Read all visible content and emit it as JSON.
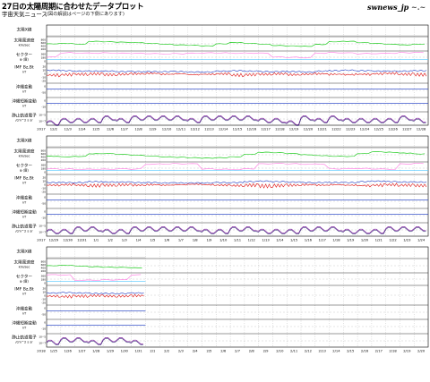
{
  "header": {
    "title": "27日の太陽周期に合わせたデータプロット",
    "subtitle": "宇宙天気ニュース",
    "note": "(図の解説はページの下側にあります)",
    "logo": "swnews_jp",
    "logo_mark": "~.~"
  },
  "colors": {
    "green": "#22cc22",
    "blue": "#1030c0",
    "red": "#e01010",
    "pink": "#ff70e0",
    "cyan": "#50c8ff",
    "purple": "#8020a0",
    "navy": "#101060",
    "gray": "#888888",
    "orange": "#ff9040"
  },
  "panel_labels": [
    {
      "id": "xray",
      "lines": [
        "太陽X線",
        "C/M/X上"
      ],
      "unit": ""
    },
    {
      "id": "wind",
      "lines": [
        "太陽風速度"
      ],
      "unit": "km/sec"
    },
    {
      "id": "sector",
      "lines": [
        "セクター"
      ],
      "unit": "φ (度)"
    },
    {
      "id": "imf",
      "lines": [
        "IMF Bz,Bt"
      ],
      "unit": "nT"
    },
    {
      "id": "dst",
      "lines": [
        "沖縄変動"
      ],
      "unit": "nT"
    },
    {
      "id": "short",
      "lines": [
        "沖縄短期変動"
      ],
      "unit": "nT"
    },
    {
      "id": "elec",
      "lines": [
        "静止軌道電子"
      ],
      "unit": "/cm^2 s sr"
    }
  ],
  "axis_ticks": {
    "wind": [
      "800",
      "600",
      "400",
      "200"
    ],
    "sector": [
      "360",
      "180",
      "0"
    ],
    "imf": [
      "20",
      "10",
      "0",
      "-10",
      "-20"
    ],
    "dst": [
      "0",
      "-50"
    ],
    "short": [
      "0",
      "-10"
    ],
    "elec": [
      "10^5",
      "10^7"
    ]
  },
  "blocks": [
    {
      "year": "2017",
      "dates": [
        "12/2",
        "12/3",
        "12/4",
        "12/5",
        "12/6",
        "12/7",
        "12/8",
        "12/9",
        "12/10",
        "12/11",
        "12/12",
        "12/13",
        "12/14",
        "12/15",
        "12/16",
        "12/17",
        "12/18",
        "12/19",
        "12/20",
        "12/21",
        "12/22",
        "12/23",
        "12/24",
        "12/25",
        "12/26",
        "12/27",
        "12/28"
      ],
      "wind": [
        500,
        520,
        480,
        620,
        600,
        580,
        560,
        520,
        480,
        450,
        430,
        400,
        500,
        560,
        520,
        480,
        420,
        400,
        380,
        470,
        600,
        620,
        560,
        520,
        480,
        450,
        480
      ],
      "sector": [
        180,
        330,
        330,
        320,
        320,
        310,
        310,
        310,
        300,
        300,
        310,
        320,
        330,
        320,
        320,
        310,
        180,
        180,
        170,
        320,
        330,
        320,
        300,
        310,
        320,
        330,
        330
      ],
      "bz": [
        -4,
        -3,
        -2,
        -1,
        -3,
        -2,
        -1,
        0,
        -2,
        -1,
        -3,
        -2,
        -1,
        -4,
        -3,
        -2,
        -1,
        -3,
        -2,
        -1,
        -2,
        -3,
        -2,
        -1,
        0,
        -2,
        -3
      ],
      "bt": [
        7,
        6,
        5,
        5,
        5,
        4,
        4,
        4,
        4,
        4,
        3,
        3,
        5,
        6,
        5,
        4,
        4,
        4,
        3,
        5,
        6,
        7,
        6,
        5,
        5,
        5,
        6
      ],
      "elec": [
        4,
        5,
        5,
        5,
        6,
        5,
        6,
        6,
        6,
        6,
        5,
        6,
        6,
        6,
        6,
        5,
        5,
        4,
        6,
        5,
        6,
        5,
        5,
        5,
        5,
        6,
        5
      ]
    },
    {
      "year": "2017",
      "dates": [
        "12/29",
        "12/30",
        "12/31",
        "1/1",
        "1/2",
        "1/3",
        "1/4",
        "1/5",
        "1/6",
        "1/7",
        "1/8",
        "1/9",
        "1/10",
        "1/11",
        "1/12",
        "1/13",
        "1/14",
        "1/15",
        "1/16",
        "1/17",
        "1/18",
        "1/19",
        "1/20",
        "1/21",
        "1/22",
        "1/23",
        "1/24"
      ],
      "wind": [
        430,
        400,
        420,
        550,
        560,
        520,
        480,
        440,
        400,
        380,
        360,
        340,
        360,
        400,
        520,
        620,
        600,
        560,
        500,
        460,
        430,
        420,
        560,
        650,
        620,
        580,
        540
      ],
      "sector": [
        150,
        150,
        150,
        150,
        140,
        150,
        150,
        320,
        330,
        330,
        320,
        150,
        150,
        140,
        160,
        320,
        330,
        330,
        320,
        320,
        150,
        160,
        170,
        160,
        150,
        320,
        330
      ],
      "bz": [
        -2,
        -1,
        -2,
        -3,
        -2,
        -1,
        -2,
        -1,
        -2,
        -1,
        0,
        -1,
        -2,
        -3,
        -2,
        -4,
        -3,
        -2,
        -1,
        -2,
        -1,
        -2,
        -3,
        -2,
        -1,
        -2,
        -3
      ],
      "bt": [
        4,
        4,
        4,
        6,
        5,
        5,
        4,
        4,
        3,
        3,
        3,
        3,
        4,
        4,
        6,
        7,
        6,
        5,
        4,
        4,
        4,
        4,
        6,
        7,
        6,
        5,
        5
      ],
      "elec": [
        5,
        5,
        6,
        6,
        5,
        5,
        6,
        6,
        6,
        6,
        6,
        5,
        5,
        6,
        6,
        5,
        5,
        5,
        6,
        6,
        6,
        5,
        5,
        5,
        6,
        6,
        6
      ]
    },
    {
      "year": "2018",
      "dates": [
        "1/25",
        "1/26",
        "1/27",
        "1/28",
        "1/29",
        "1/30",
        "1/31",
        "2/1",
        "2/2",
        "2/3",
        "2/4",
        "2/5",
        "2/6",
        "2/7",
        "2/8",
        "2/9",
        "2/10",
        "2/11",
        "2/12",
        "2/13",
        "2/14",
        "2/15",
        "2/16",
        "2/17",
        "2/18",
        "2/19",
        "2/20"
      ],
      "wind": [
        500,
        520,
        480,
        450,
        430,
        420,
        400
      ],
      "sector": [
        320,
        320,
        150,
        150,
        150,
        150,
        320
      ],
      "bz": [
        -2,
        -3,
        -2,
        -1,
        -2,
        -2,
        -1
      ],
      "bt": [
        5,
        6,
        5,
        4,
        4,
        4,
        5
      ],
      "elec": [
        5,
        6,
        6,
        5,
        6,
        6,
        5
      ]
    }
  ]
}
